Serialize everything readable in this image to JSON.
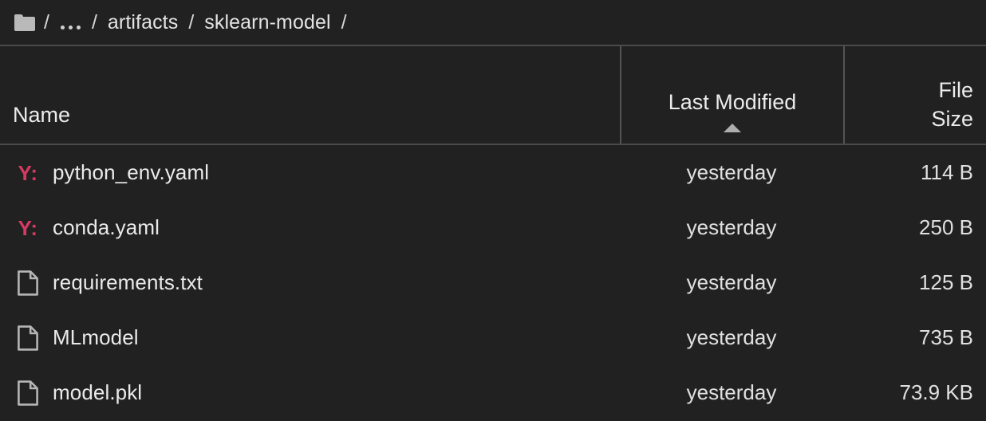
{
  "breadcrumb": {
    "root_icon": "folder-icon",
    "separator": "/",
    "items": [
      {
        "label": "…",
        "type": "ellipsis"
      },
      {
        "label": "artifacts",
        "type": "crumb"
      },
      {
        "label": "sklearn-model",
        "type": "crumb"
      }
    ],
    "trailing_separator": "/"
  },
  "table": {
    "columns": [
      {
        "key": "name",
        "label": "Name",
        "align": "left",
        "sorted": false
      },
      {
        "key": "last_modified",
        "label": "Last Modified",
        "align": "center",
        "sorted": true,
        "sort_direction": "ascending",
        "sort_icon": "sort-ascending-arrow"
      },
      {
        "key": "file_size",
        "label": "File\nSize",
        "label_line1": "File",
        "label_line2": "Size",
        "align": "right",
        "sorted": false
      }
    ],
    "rows": [
      {
        "icon": "yaml-file-icon",
        "icon_glyph": "Y:",
        "name": "python_env.yaml",
        "last_modified": "yesterday",
        "file_size": "114 B"
      },
      {
        "icon": "yaml-file-icon",
        "icon_glyph": "Y:",
        "name": "conda.yaml",
        "last_modified": "yesterday",
        "file_size": "250 B"
      },
      {
        "icon": "document-file-icon",
        "icon_glyph": "",
        "name": "requirements.txt",
        "last_modified": "yesterday",
        "file_size": "125 B"
      },
      {
        "icon": "document-file-icon",
        "icon_glyph": "",
        "name": "MLmodel",
        "last_modified": "yesterday",
        "file_size": "735 B"
      },
      {
        "icon": "document-file-icon",
        "icon_glyph": "",
        "name": "model.pkl",
        "last_modified": "yesterday",
        "file_size": "73.9 KB"
      }
    ]
  },
  "colors": {
    "background": "#212121",
    "divider": "#4a4a4a",
    "text_primary": "#eaeaea",
    "yaml_accent": "#d63a62",
    "icon_gray": "#b9b9b9"
  }
}
